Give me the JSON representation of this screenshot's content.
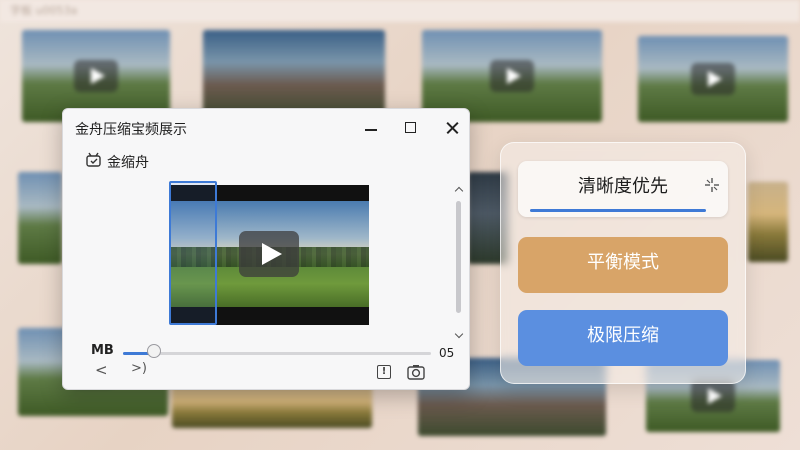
{
  "background": {
    "app_title": "字板   u0053a"
  },
  "window": {
    "title": "金舟压缩宝频展示",
    "brand_label": "金缩舟",
    "mb_label": "MB",
    "end_label": "05",
    "nav_prev": "<",
    "nav_next": ">)",
    "info_glyph": "!",
    "slider_fraction": 0.1
  },
  "modes": {
    "clarity_label": "清晰度优先",
    "balance_label": "平衡模式",
    "limit_label": "极限压缩"
  },
  "colors": {
    "accent_blue": "#3e7ad6",
    "balance_orange": "#d8a468",
    "limit_blue": "#5b8fe0"
  }
}
